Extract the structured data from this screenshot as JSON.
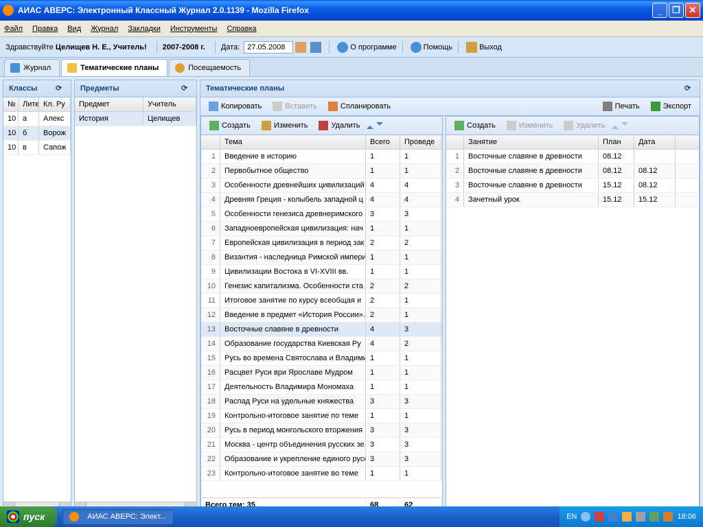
{
  "window": {
    "title": "АИАС АВЕРС: Электронный Классный Журнал 2.0.1139 - Mozilla Firefox"
  },
  "menubar": [
    "Файл",
    "Правка",
    "Вид",
    "Журнал",
    "Закладки",
    "Инструменты",
    "Справка"
  ],
  "toolbar": {
    "greeting": "Здравствуйте ",
    "user": "Целищев Н. Е., Учитель!",
    "year": "2007-2008 г.",
    "date_label": "Дата:",
    "date_value": "27.05.2008",
    "about": "О программе",
    "help": "Помощь",
    "exit": "Выход"
  },
  "tabs": {
    "journal": "Журнал",
    "plans": "Тематические планы",
    "attendance": "Посещаемость"
  },
  "classes": {
    "title": "Классы",
    "cols": [
      "№",
      "Лите",
      "Кл. Ру"
    ],
    "rows": [
      {
        "n": "10",
        "l": "а",
        "t": "Алекс"
      },
      {
        "n": "10",
        "l": "б",
        "t": "Ворож"
      },
      {
        "n": "10",
        "l": "в",
        "t": "Сапож"
      }
    ]
  },
  "subjects": {
    "title": "Предметы",
    "cols": [
      "Предмет",
      "Учитель"
    ],
    "rows": [
      {
        "s": "История",
        "t": "Целищев"
      }
    ]
  },
  "main": {
    "title": "Тематические планы",
    "tb1": {
      "copy": "Копировать",
      "paste": "Вставить",
      "plan": "Спланировать",
      "print": "Печать",
      "export": "Экспорт"
    },
    "tb2": {
      "create": "Создать",
      "edit": "Изменить",
      "delete": "Удалить"
    }
  },
  "themes": {
    "cols": [
      "",
      "Тема",
      "Всего",
      "Проведе"
    ],
    "rows": [
      {
        "n": 1,
        "t": "Введение в историю",
        "a": 1,
        "d": 1
      },
      {
        "n": 2,
        "t": "Первобытное общество",
        "a": 1,
        "d": 1
      },
      {
        "n": 3,
        "t": "Особенности древнейших цивилизаций",
        "a": 4,
        "d": 4
      },
      {
        "n": 4,
        "t": "Древняя Греция - колыбель западной ц",
        "a": 4,
        "d": 4
      },
      {
        "n": 5,
        "t": "Особенности генезиса древнеримского",
        "a": 3,
        "d": 3
      },
      {
        "n": 6,
        "t": "Западноевропейская цивилизация: нач",
        "a": 1,
        "d": 1
      },
      {
        "n": 7,
        "t": "Европейская цивилизация в период зак",
        "a": 2,
        "d": 2
      },
      {
        "n": 8,
        "t": "Византия - наследница Римской импери",
        "a": 1,
        "d": 1
      },
      {
        "n": 9,
        "t": "Цивилизации Востока в VI-XVIII вв.",
        "a": 1,
        "d": 1
      },
      {
        "n": 10,
        "t": "Генезис капитализма. Особенности ста",
        "a": 2,
        "d": 2
      },
      {
        "n": 11,
        "t": "Итоговое занятие по курсу всеобщая и",
        "a": 2,
        "d": 1
      },
      {
        "n": 12,
        "t": "Введение в предмет «История России».",
        "a": 2,
        "d": 1
      },
      {
        "n": 13,
        "t": "Восточные славяне в древности",
        "a": 4,
        "d": 3
      },
      {
        "n": 14,
        "t": "Образование государства Киевская Ру",
        "a": 4,
        "d": 2
      },
      {
        "n": 15,
        "t": "Русь во времена Святослава и Владими",
        "a": 1,
        "d": 1
      },
      {
        "n": 16,
        "t": "Расцвет Руси ври Ярославе Мудром",
        "a": 1,
        "d": 1
      },
      {
        "n": 17,
        "t": "Деятельность Владимира Мономаха",
        "a": 1,
        "d": 1
      },
      {
        "n": 18,
        "t": "Распад Руси на удельные княжества",
        "a": 3,
        "d": 3
      },
      {
        "n": 19,
        "t": "Контрольно-итоговое занятие по теме",
        "a": 1,
        "d": 1
      },
      {
        "n": 20,
        "t": "Русь в период монгольского вторжения",
        "a": 3,
        "d": 3
      },
      {
        "n": 21,
        "t": "Москва - центр объединения русских зе",
        "a": 3,
        "d": 3
      },
      {
        "n": 22,
        "t": "Образование и укрепление единого русс",
        "a": 3,
        "d": 3
      },
      {
        "n": 23,
        "t": "Контрольно-итоговое занятие во теме",
        "a": 1,
        "d": 1
      }
    ],
    "footer": {
      "label": "Всего тем: 35",
      "a": "68",
      "d": "62"
    }
  },
  "lessons": {
    "cols": [
      "",
      "Занятие",
      "План",
      "Дата"
    ],
    "rows": [
      {
        "n": 1,
        "t": "Восточные славяне в древности",
        "p": "08.12",
        "d": ""
      },
      {
        "n": 2,
        "t": "Восточные славяне в древности",
        "p": "08.12",
        "d": "08.12"
      },
      {
        "n": 3,
        "t": "Восточные славяне в древности",
        "p": "15.12",
        "d": "08.12"
      },
      {
        "n": 4,
        "t": "Зачетный урок",
        "p": "15.12",
        "d": "15.12"
      }
    ]
  },
  "taskbar": {
    "start": "пуск",
    "app": "АИАС АВЕРС: Элект...",
    "lang": "EN",
    "time": "18:06"
  }
}
